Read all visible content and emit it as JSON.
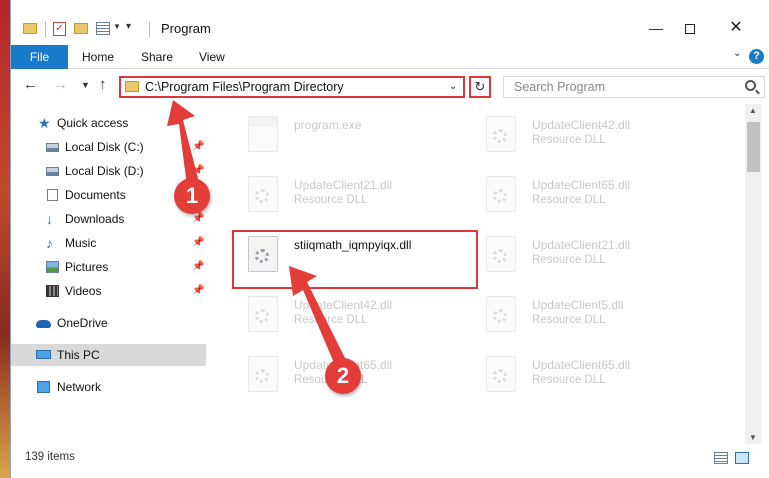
{
  "titlebar": {
    "title": "Program",
    "minimize": "—",
    "close": "✕"
  },
  "ribbon": {
    "file": "File",
    "home": "Home",
    "share": "Share",
    "view": "View",
    "help": "?"
  },
  "nav": {
    "address": "C:\\Program Files\\Program Directory",
    "search_placeholder": "Search Program"
  },
  "sidebar": {
    "items": [
      {
        "label": "Quick access"
      },
      {
        "label": "Local Disk (C:)"
      },
      {
        "label": "Local Disk (D:)"
      },
      {
        "label": "Documents"
      },
      {
        "label": "Downloads"
      },
      {
        "label": "Music"
      },
      {
        "label": "Pictures"
      },
      {
        "label": "Videos"
      },
      {
        "label": "OneDrive"
      },
      {
        "label": "This PC"
      },
      {
        "label": "Network"
      }
    ]
  },
  "files": [
    {
      "name": "program.exe",
      "type": ""
    },
    {
      "name": "UpdateClient42.dll",
      "type": "Resource DLL"
    },
    {
      "name": "UpdateClient21.dll",
      "type": "Resource DLL"
    },
    {
      "name": "UpdateClient65.dll",
      "type": "Resource DLL"
    },
    {
      "name": "stiiqmath_iqmpyiqx.dll",
      "type": ""
    },
    {
      "name": "UpdateClient21.dll",
      "type": "Resource DLL"
    },
    {
      "name": "UpdateClient42.dll",
      "type": "Resource DLL"
    },
    {
      "name": "UpdateClient5.dll",
      "type": "Resource DLL"
    },
    {
      "name": "UpdateClient65.dll",
      "type": "Resource DLL"
    },
    {
      "name": "UpdateClient65.dll",
      "type": "Resource DLL"
    }
  ],
  "status": {
    "item_count": "139 items"
  },
  "callouts": {
    "one": "1",
    "two": "2"
  },
  "colors": {
    "accent": "#1979ca",
    "highlight": "#e0353b",
    "callout": "#e33d3a"
  }
}
